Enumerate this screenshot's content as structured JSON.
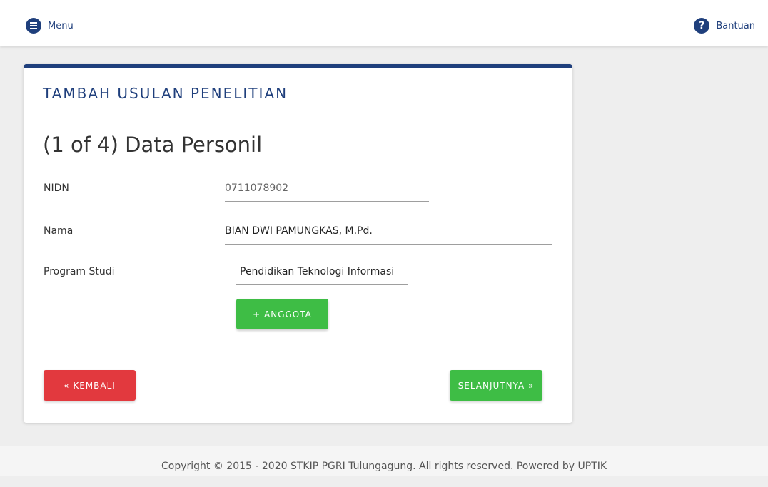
{
  "header": {
    "menu_label": "Menu",
    "menu_icon": "hamburger-menu-icon",
    "help_label": "Bantuan",
    "help_icon": "question-circle-icon"
  },
  "form": {
    "heading": "Tambah Usulan Penelitian",
    "step_title": "(1 of 4) Data Personil",
    "fields": [
      {
        "label": "NIDN",
        "value": "0711078902"
      },
      {
        "label": "Nama",
        "value": "BIAN DWI PAMUNGKAS, M.Pd."
      },
      {
        "label": "Program Studi",
        "value": "Pendidikan Teknologi Informasi"
      }
    ],
    "add_member_label": "+ ANGGOTA",
    "back_label": "« KEMBALI",
    "next_label": "SELANJUTNYA »"
  },
  "footer": {
    "copyright": "Copyright © 2015 - 2020 STKIP PGRI Tulungagung. All rights reserved. Powered by UPTIK"
  },
  "colors": {
    "brand": "#1f3f7c",
    "success": "#3ebd45",
    "danger": "#e2393e"
  }
}
